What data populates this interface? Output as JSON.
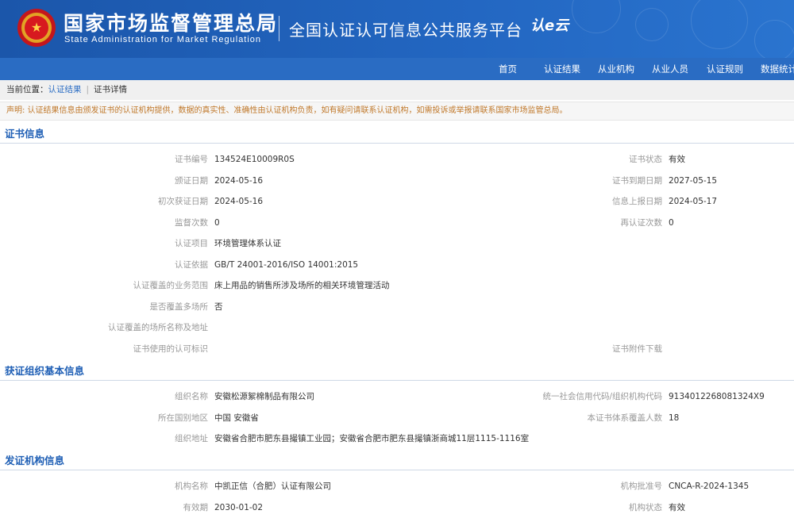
{
  "header": {
    "org_title": "国家市场监督管理总局",
    "org_subtitle": "State Administration  for  Market Regulation",
    "platform_title": "全国认证认可信息公共服务平台",
    "platform_logo": "认e云",
    "emblem_icon": "national-emblem-icon"
  },
  "nav": {
    "items": [
      "首页",
      "认证结果",
      "从业机构",
      "从业人员",
      "认证规则",
      "数据统计"
    ]
  },
  "breadcrumb": {
    "prefix": "当前位置：",
    "link": "认证结果",
    "separator": "|",
    "current": "证书详情"
  },
  "notice": "声明: 认证结果信息由颁发证书的认证机构提供，数据的真实性、准确性由认证机构负责，如有疑问请联系认证机构，如需投诉或举报请联系国家市场监管总局。",
  "cert_section": {
    "title": "证书信息",
    "rows": [
      {
        "l1": "证书编号",
        "v1": "134524E10009R0S",
        "l2": "证书状态",
        "v2": "有效"
      },
      {
        "l1": "颁证日期",
        "v1": "2024-05-16",
        "l2": "证书到期日期",
        "v2": "2027-05-15"
      },
      {
        "l1": "初次获证日期",
        "v1": "2024-05-16",
        "l2": "信息上报日期",
        "v2": "2024-05-17"
      },
      {
        "l1": "监督次数",
        "v1": "0",
        "l2": "再认证次数",
        "v2": "0"
      },
      {
        "l1": "认证项目",
        "v1": "环境管理体系认证",
        "l2": "",
        "v2": ""
      },
      {
        "l1": "认证依据",
        "v1": "GB/T 24001-2016/ISO 14001:2015",
        "l2": "",
        "v2": ""
      },
      {
        "l1": "认证覆盖的业务范围",
        "v1": "床上用品的销售所涉及场所的相关环境管理活动",
        "l2": "",
        "v2": ""
      },
      {
        "l1": "是否覆盖多场所",
        "v1": "否",
        "l2": "",
        "v2": ""
      },
      {
        "l1": "认证覆盖的场所名称及地址",
        "v1": "",
        "l2": "",
        "v2": ""
      },
      {
        "l1": "证书使用的认可标识",
        "v1": "",
        "l2": "证书附件下载",
        "v2": ""
      }
    ]
  },
  "org_section": {
    "title": "获证组织基本信息",
    "rows": [
      {
        "l1": "组织名称",
        "v1": "安徽松源絮棉制品有限公司",
        "l2": "统一社会信用代码/组织机构代码",
        "v2": "9134012268081324X9"
      },
      {
        "l1": "所在国别地区",
        "v1": "中国 安徽省",
        "l2": "本证书体系覆盖人数",
        "v2": "18"
      },
      {
        "l1": "组织地址",
        "v1": "安徽省合肥市肥东县撮镇工业园；安徽省合肥市肥东县撮镇浙商城11层1115-1116室",
        "l2": "",
        "v2": ""
      }
    ]
  },
  "issuer_section": {
    "title": "发证机构信息",
    "rows": [
      {
        "l1": "机构名称",
        "v1": "中凯正信（合肥）认证有限公司",
        "l2": "机构批准号",
        "v2": "CNCA-R-2024-1345"
      },
      {
        "l1": "有效期",
        "v1": "2030-01-02",
        "l2": "机构状态",
        "v2": "有效"
      }
    ]
  }
}
